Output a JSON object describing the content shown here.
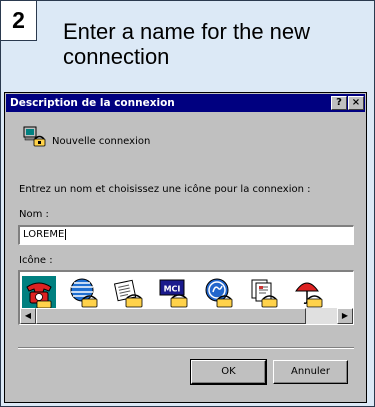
{
  "step": {
    "number": "2",
    "instruction": "Enter a name for the new connection"
  },
  "dialog": {
    "title": "Description de la connexion",
    "help_button": "?",
    "close_button": "×",
    "connection_label": "Nouvelle connexion",
    "prompt": "Entrez un nom et choisissez une icône pour la connexion :",
    "name_label": "Nom :",
    "name_value": "LOREME",
    "icon_label": "Icône :",
    "icons": [
      {
        "name": "red-telephone-icon",
        "selected": true
      },
      {
        "name": "globe-phone-icon"
      },
      {
        "name": "newspaper-phone-icon"
      },
      {
        "name": "mci-phone-icon",
        "text": "MCI"
      },
      {
        "name": "ge-logo-phone-icon"
      },
      {
        "name": "documents-phone-icon"
      },
      {
        "name": "umbrella-phone-icon"
      }
    ],
    "ok_label": "OK",
    "cancel_label": "Annuler"
  },
  "colors": {
    "card_bg": "#dce9f6",
    "titlebar": "#000080",
    "dialog_face": "#c0c0c0",
    "icon_selection": "#008080"
  }
}
